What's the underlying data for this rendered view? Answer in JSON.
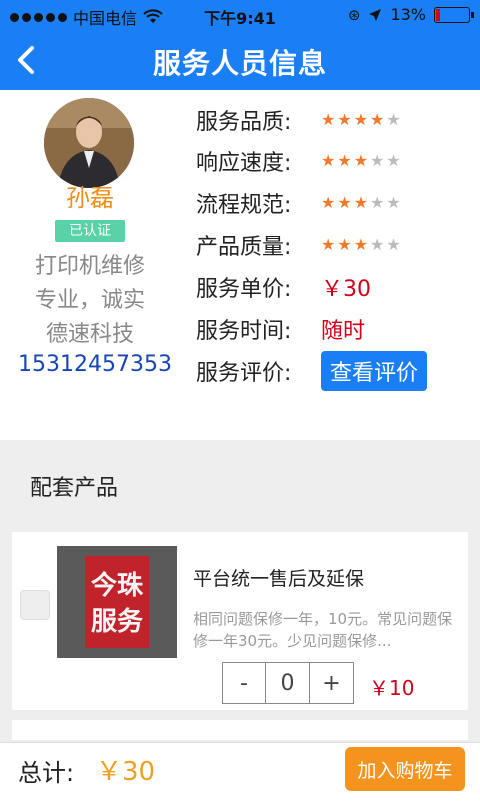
{
  "status_bar": {
    "carrier": "中国电信",
    "time": "下午9:41",
    "battery": "13%"
  },
  "nav": {
    "title": "服务人员信息"
  },
  "profile": {
    "name": "孙磊",
    "badge": "已认证",
    "desc_lines": [
      "打印机维修",
      "专业，诚实",
      "德速科技"
    ],
    "phone": "15312457353"
  },
  "ratings": [
    {
      "label": "服务品质:",
      "stars": 4
    },
    {
      "label": "响应速度:",
      "stars": 3
    },
    {
      "label": "流程规范:",
      "stars": 3
    },
    {
      "label": "产品质量:",
      "stars": 3
    }
  ],
  "info": {
    "price_label": "服务单价:",
    "price_value": "￥30",
    "time_label": "服务时间:",
    "time_value": "随时",
    "review_label": "服务评价:",
    "review_button": "查看评价"
  },
  "section": {
    "title": "配套产品"
  },
  "product": {
    "image_text": [
      "今珠",
      "服务"
    ],
    "title": "平台统一售后及延保",
    "desc": "相同问题保修一年，10元。常见问题保修一年30元。少见问题保修...",
    "minus": "-",
    "qty": "0",
    "plus": "+",
    "price": "￥10"
  },
  "footer": {
    "total_label": "总计:",
    "total_value": "￥30",
    "cart_button": "加入购物车"
  },
  "colors": {
    "brand": "#1a7ef5",
    "star": "#f07a28",
    "price": "#d0021b",
    "cart": "#f4931e"
  }
}
